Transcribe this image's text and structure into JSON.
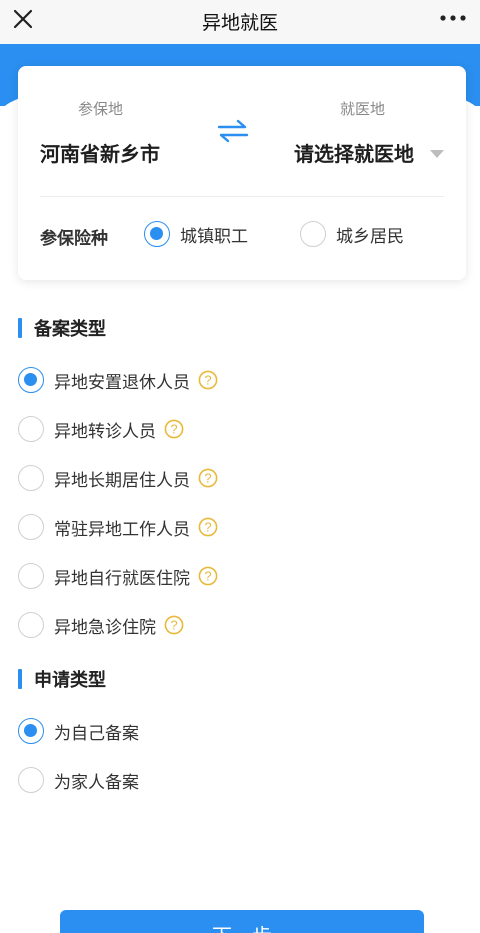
{
  "header": {
    "title": "异地就医",
    "close_icon": "close-icon",
    "more_icon": "more-icon"
  },
  "location": {
    "insured_label": "参保地",
    "insured_value": "河南省新乡市",
    "treatment_label": "就医地",
    "treatment_value": "请选择就医地",
    "swap_icon": "swap-arrows-icon",
    "dropdown_icon": "caret-down-icon"
  },
  "insurance": {
    "label": "参保险种",
    "options": [
      {
        "label": "城镇职工",
        "selected": true
      },
      {
        "label": "城乡居民",
        "selected": false
      }
    ]
  },
  "record_type": {
    "title": "备案类型",
    "options": [
      {
        "label": "异地安置退休人员",
        "selected": true
      },
      {
        "label": "异地转诊人员",
        "selected": false
      },
      {
        "label": "异地长期居住人员",
        "selected": false
      },
      {
        "label": "常驻异地工作人员",
        "selected": false
      },
      {
        "label": "异地自行就医住院",
        "selected": false
      },
      {
        "label": "异地急诊住院",
        "selected": false
      }
    ]
  },
  "apply_type": {
    "title": "申请类型",
    "options": [
      {
        "label": "为自己备案",
        "selected": true
      },
      {
        "label": "为家人备案",
        "selected": false
      }
    ]
  },
  "footer": {
    "next_label": "下一步"
  },
  "colors": {
    "accent": "#2a8ff0",
    "help": "#e8b93a"
  }
}
